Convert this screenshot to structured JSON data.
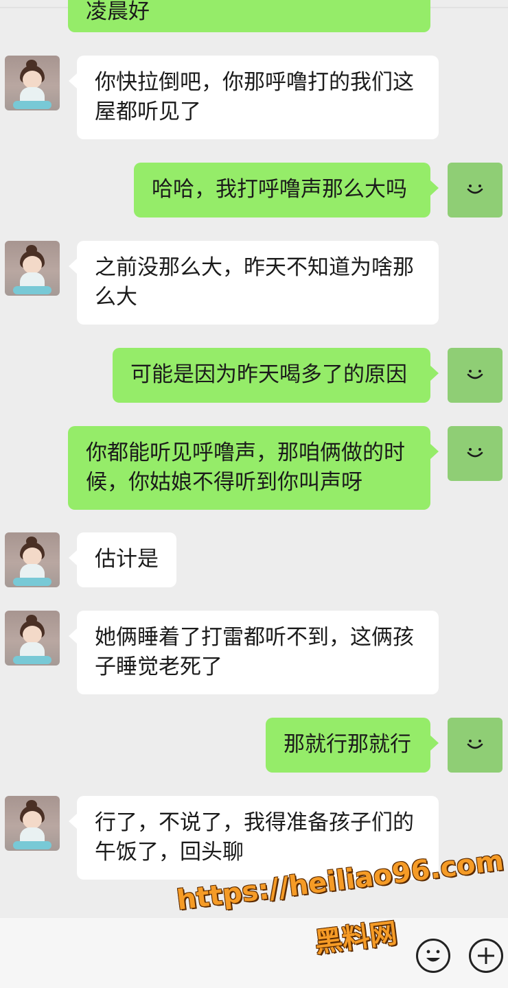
{
  "messages": [
    {
      "id": "m0",
      "side": "out",
      "text": "凌晨好",
      "clipped": true
    },
    {
      "id": "m1",
      "side": "in",
      "text": "你快拉倒吧，你那呼噜打的我们这屋都听见了"
    },
    {
      "id": "m2",
      "side": "out",
      "text": "哈哈，我打呼噜声那么大吗"
    },
    {
      "id": "m3",
      "side": "in",
      "text": "之前没那么大，昨天不知道为啥那么大"
    },
    {
      "id": "m4",
      "side": "out",
      "text": "可能是因为昨天喝多了的原因"
    },
    {
      "id": "m5",
      "side": "out",
      "text": "你都能听见呼噜声，那咱俩做的时候，你姑娘不得听到你叫声呀"
    },
    {
      "id": "m6",
      "side": "in",
      "text": "估计是"
    },
    {
      "id": "m7",
      "side": "in",
      "text": "她俩睡着了打雷都听不到，这俩孩子睡觉老死了"
    },
    {
      "id": "m8",
      "side": "out",
      "text": "那就行那就行"
    },
    {
      "id": "m9",
      "side": "in",
      "text": "行了，不说了，我得准备孩子们的午饭了，回头聊"
    }
  ],
  "watermark": {
    "url": "https://heiliao96.com",
    "name": "黑料网"
  },
  "icons": {
    "contact_avatar": "girl-avatar-icon",
    "my_avatar": "smiley-avatar-icon",
    "emoji": "emoji-icon",
    "plus": "plus-icon"
  },
  "colors": {
    "background": "#ededed",
    "incoming_bubble": "#ffffff",
    "outgoing_bubble": "#95ec69",
    "my_avatar": "#8fce75",
    "watermark": "#f59b26"
  }
}
